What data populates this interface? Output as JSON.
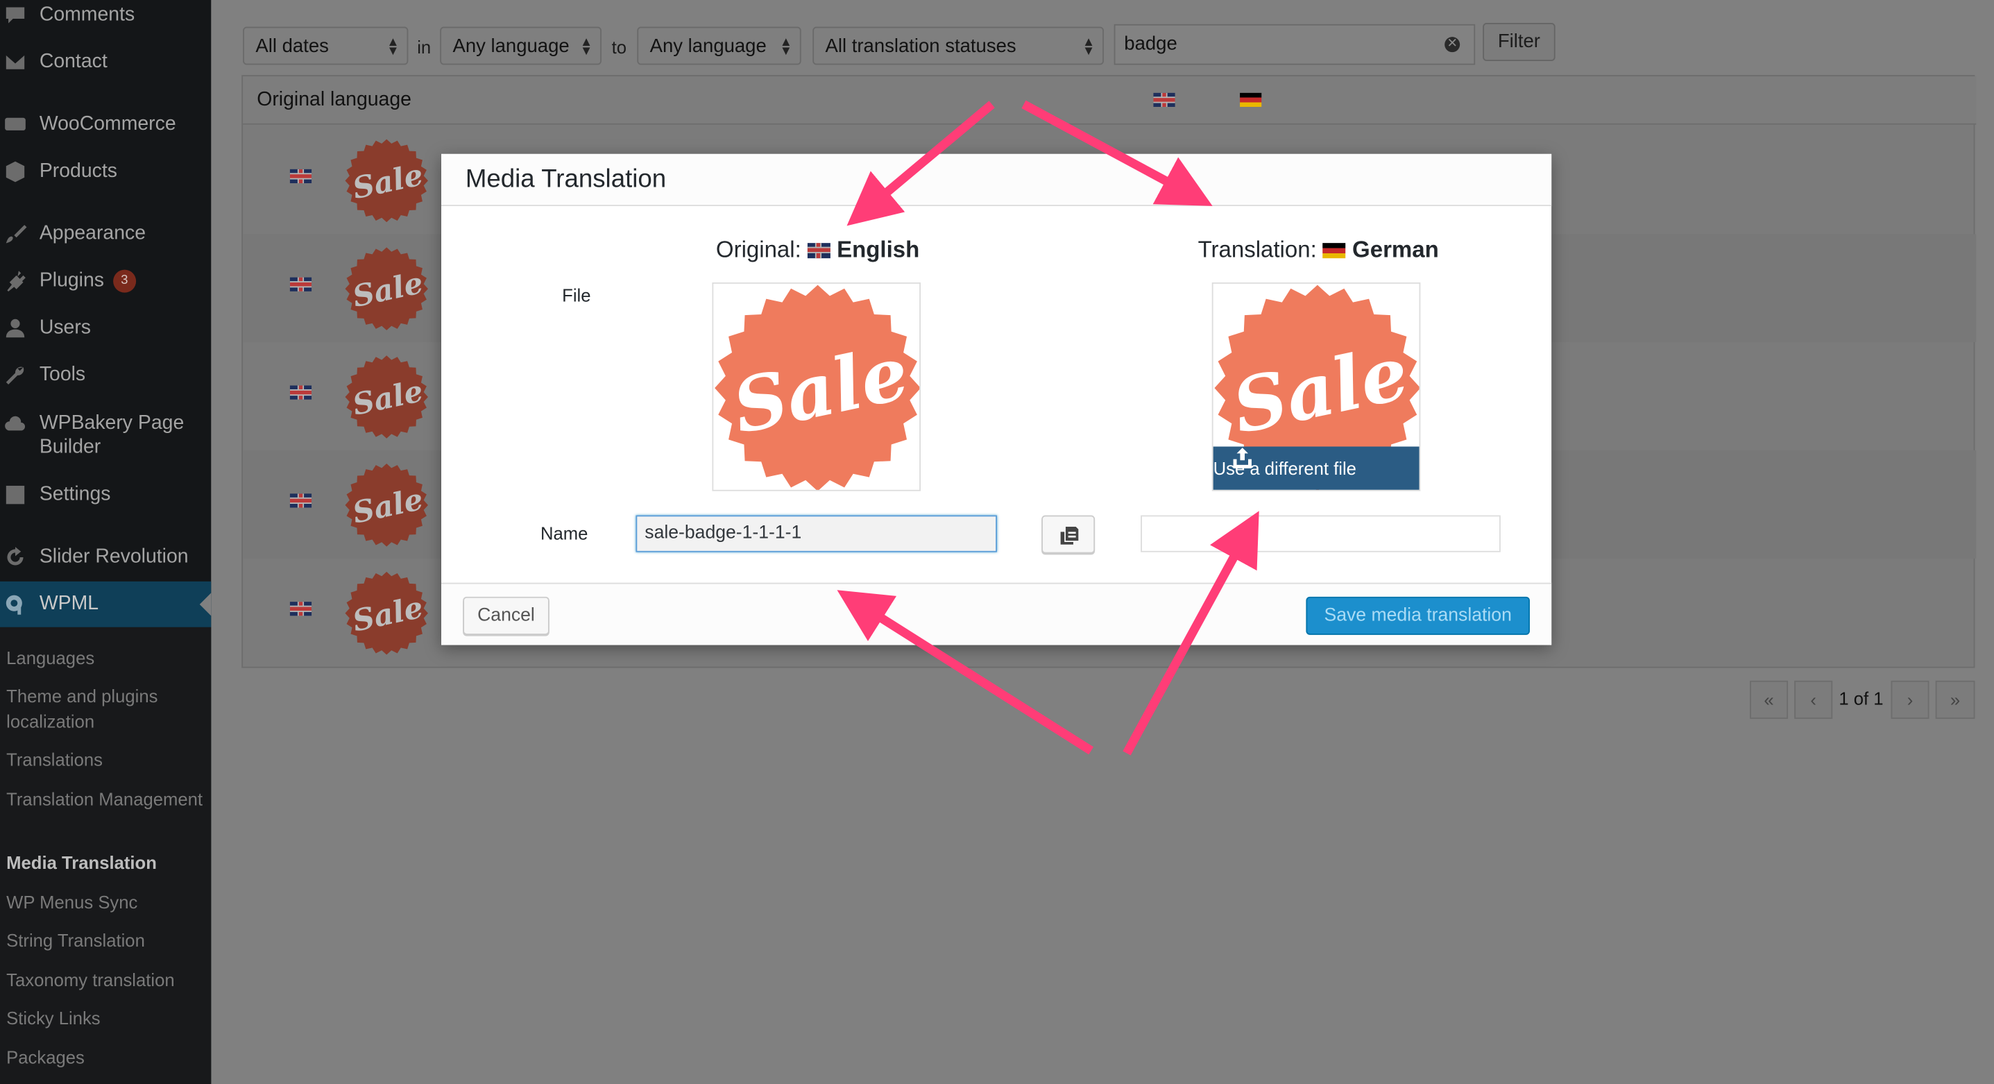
{
  "sidebar": {
    "items": [
      {
        "label": "Comments",
        "icon": "comment-icon"
      },
      {
        "label": "Contact",
        "icon": "mail-icon"
      },
      {
        "label": "WooCommerce",
        "icon": "woo-icon"
      },
      {
        "label": "Products",
        "icon": "box-icon"
      },
      {
        "label": "Appearance",
        "icon": "brush-icon"
      },
      {
        "label": "Plugins",
        "icon": "plug-icon",
        "badge": "3"
      },
      {
        "label": "Users",
        "icon": "user-icon"
      },
      {
        "label": "Tools",
        "icon": "wrench-icon"
      },
      {
        "label": "WPBakery Page Builder",
        "icon": "cloud-icon"
      },
      {
        "label": "Settings",
        "icon": "sliders-icon"
      },
      {
        "label": "Slider Revolution",
        "icon": "refresh-icon"
      },
      {
        "label": "WPML",
        "icon": "wpml-icon"
      }
    ],
    "submenu": [
      "Languages",
      "Theme and plugins localization",
      "Translations",
      "Translation Management",
      "Media Translation",
      "WP Menus Sync",
      "String Translation",
      "Taxonomy translation",
      "Sticky Links",
      "Packages"
    ]
  },
  "filters": {
    "dates": "All dates",
    "in_text": "in",
    "from_language": "Any language",
    "to_text": "to",
    "to_language": "Any language",
    "status": "All translation statuses",
    "search_value": "badge",
    "filter_label": "Filter"
  },
  "table": {
    "header": "Original language",
    "row_count": 5
  },
  "pagination": {
    "first": "«",
    "prev": "‹",
    "page_text": "1 of 1",
    "next": "›",
    "last": "»"
  },
  "modal": {
    "title": "Media Translation",
    "original_label": "Original:",
    "original_language": "English",
    "translation_label": "Translation:",
    "translation_language": "German",
    "file_label": "File",
    "name_label": "Name",
    "name_value": "sale-badge-1-1-1-1",
    "upload_label": "Use a different file",
    "cancel_label": "Cancel",
    "save_label": "Save media translation",
    "badge_text": "Sale"
  },
  "colors": {
    "sale_badge": "#ef7b5d",
    "arrow": "#ff3d77",
    "primary_button": "#1c8fcd",
    "upload_bar": "#2b5c84"
  }
}
